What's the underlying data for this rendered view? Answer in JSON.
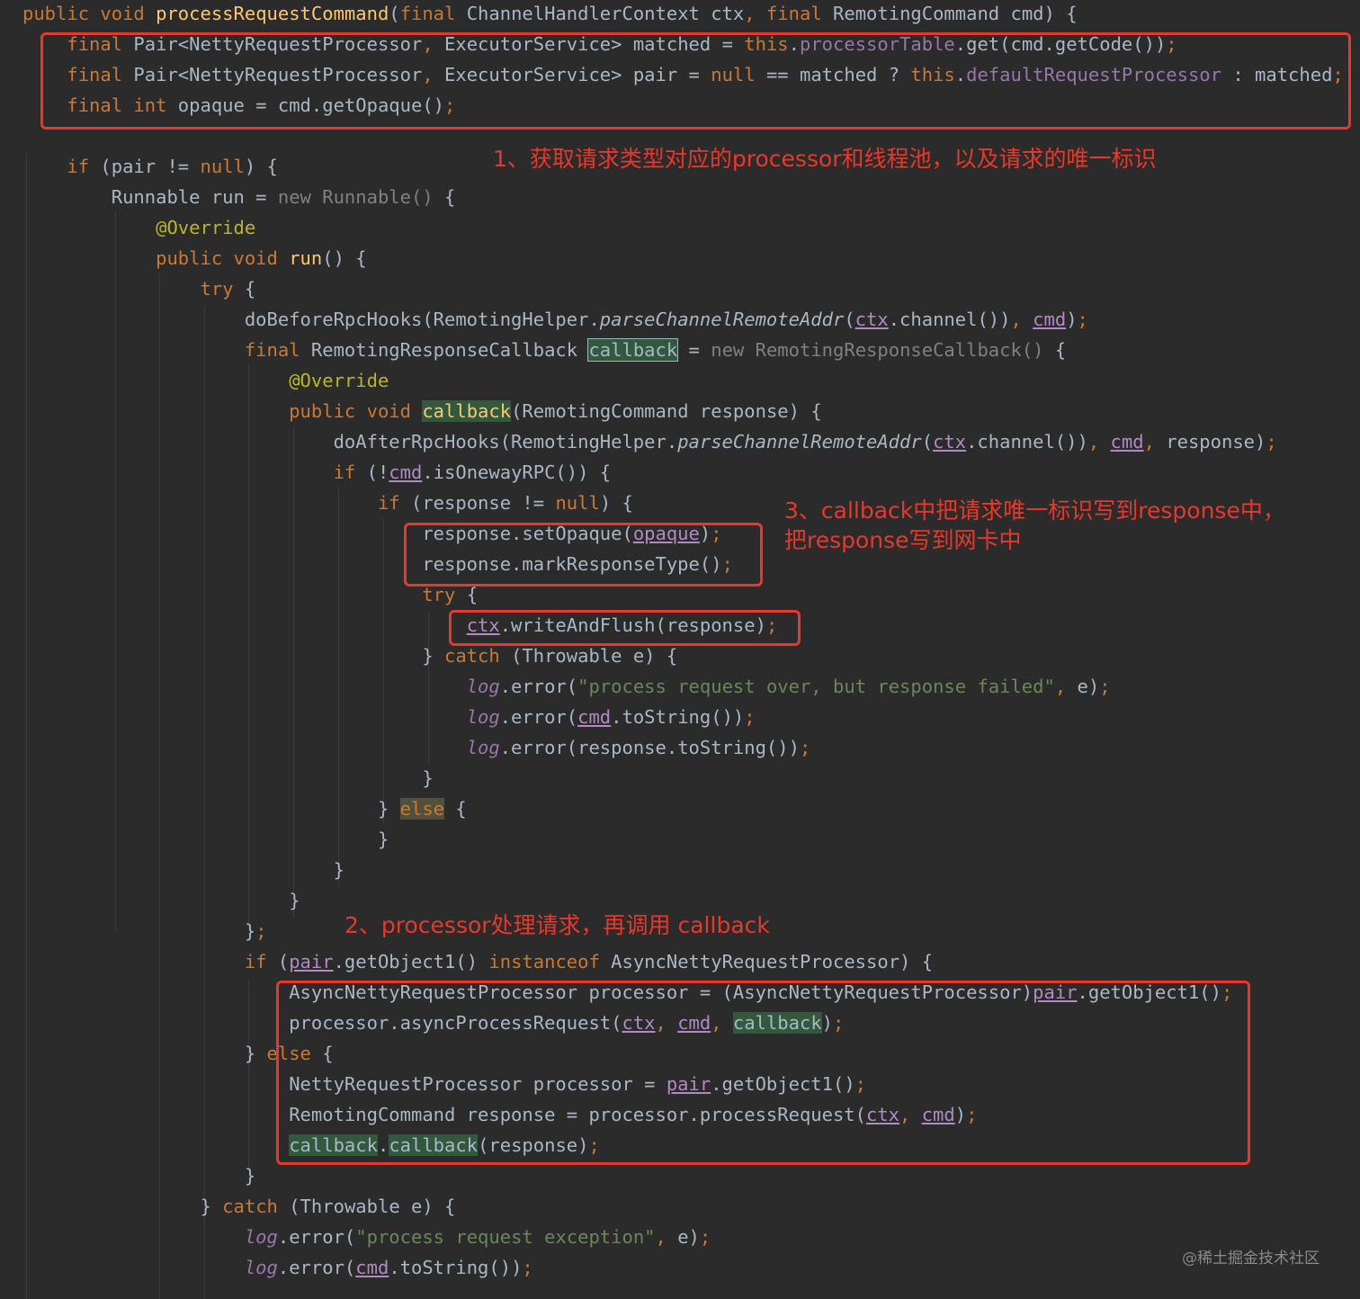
{
  "code_lines": [
    {
      "n": 0,
      "tokens": [
        [
          "public void ",
          "k"
        ],
        [
          "processRequestCommand",
          "m"
        ],
        [
          "(",
          "t"
        ],
        [
          "final ",
          "k"
        ],
        [
          "ChannelHandlerContext ctx",
          "t"
        ],
        [
          ", ",
          "k"
        ],
        [
          "final ",
          "k"
        ],
        [
          "RemotingCommand cmd) {",
          "t"
        ]
      ]
    },
    {
      "n": 1,
      "tokens": [
        [
          "    final ",
          "k"
        ],
        [
          "Pair<NettyRequestProcessor",
          "t"
        ],
        [
          ", ",
          "k"
        ],
        [
          "ExecutorService> matched = ",
          "t"
        ],
        [
          "this",
          "k"
        ],
        [
          ".",
          "t"
        ],
        [
          "processorTable",
          "f"
        ],
        [
          ".get(cmd.getCode())",
          "t"
        ],
        [
          ";",
          "k"
        ]
      ]
    },
    {
      "n": 2,
      "tokens": [
        [
          "    final ",
          "k"
        ],
        [
          "Pair<NettyRequestProcessor",
          "t"
        ],
        [
          ", ",
          "k"
        ],
        [
          "ExecutorService> pair = ",
          "t"
        ],
        [
          "null ",
          "k"
        ],
        [
          "== matched ? ",
          "t"
        ],
        [
          "this",
          "k"
        ],
        [
          ".",
          "t"
        ],
        [
          "defaultRequestProcessor",
          "f"
        ],
        [
          " : matched",
          "t"
        ],
        [
          ";",
          "k"
        ]
      ]
    },
    {
      "n": 3,
      "tokens": [
        [
          "    final int ",
          "k"
        ],
        [
          "opaque = cmd.getOpaque()",
          "t"
        ],
        [
          ";",
          "k"
        ]
      ]
    },
    {
      "n": 5,
      "tokens": [
        [
          "    if ",
          "k"
        ],
        [
          "(pair != ",
          "t"
        ],
        [
          "null",
          "k"
        ],
        [
          ") {",
          "t"
        ]
      ]
    },
    {
      "n": 6,
      "tokens": [
        [
          "        Runnable run = ",
          "t"
        ],
        [
          "new Runnable() ",
          "g"
        ],
        [
          "{",
          "t"
        ]
      ]
    },
    {
      "n": 7,
      "tokens": [
        [
          "            @Override",
          "a"
        ]
      ]
    },
    {
      "n": 8,
      "tokens": [
        [
          "            public void ",
          "k"
        ],
        [
          "run",
          "m"
        ],
        [
          "() {",
          "t"
        ]
      ]
    },
    {
      "n": 9,
      "tokens": [
        [
          "                try ",
          "k"
        ],
        [
          "{",
          "t"
        ]
      ]
    },
    {
      "n": 10,
      "tokens": [
        [
          "                    doBeforeRpcHooks(RemotingHelper.",
          "t"
        ],
        [
          "parseChannelRemoteAddr",
          "i"
        ],
        [
          "(",
          "t"
        ],
        [
          "ctx",
          "u"
        ],
        [
          ".channel())",
          "t"
        ],
        [
          ", ",
          "k"
        ],
        [
          "cmd",
          "u"
        ],
        [
          ")",
          "t"
        ],
        [
          ";",
          "k"
        ]
      ]
    },
    {
      "n": 11,
      "tokens": [
        [
          "                    final ",
          "k"
        ],
        [
          "RemotingResponseCallback ",
          "t"
        ],
        [
          "callback",
          "hb"
        ],
        [
          " = ",
          "t"
        ],
        [
          "new RemotingResponseCallback() ",
          "g"
        ],
        [
          "{",
          "t"
        ]
      ]
    },
    {
      "n": 12,
      "tokens": [
        [
          "                        @Override",
          "a"
        ]
      ]
    },
    {
      "n": 13,
      "tokens": [
        [
          "                        public void ",
          "k"
        ],
        [
          "callback",
          "hm"
        ],
        [
          "(RemotingCommand response) {",
          "t"
        ]
      ]
    },
    {
      "n": 14,
      "tokens": [
        [
          "                            doAfterRpcHooks(RemotingHelper.",
          "t"
        ],
        [
          "parseChannelRemoteAddr",
          "i"
        ],
        [
          "(",
          "t"
        ],
        [
          "ctx",
          "u"
        ],
        [
          ".channel())",
          "t"
        ],
        [
          ", ",
          "k"
        ],
        [
          "cmd",
          "u"
        ],
        [
          ", ",
          "k"
        ],
        [
          "response)",
          "t"
        ],
        [
          ";",
          "k"
        ]
      ]
    },
    {
      "n": 15,
      "tokens": [
        [
          "                            if ",
          "k"
        ],
        [
          "(!",
          "t"
        ],
        [
          "cmd",
          "u"
        ],
        [
          ".isOnewayRPC()) {",
          "t"
        ]
      ]
    },
    {
      "n": 16,
      "tokens": [
        [
          "                                if ",
          "k"
        ],
        [
          "(response != ",
          "t"
        ],
        [
          "null",
          "k"
        ],
        [
          ") {",
          "t"
        ]
      ]
    },
    {
      "n": 17,
      "tokens": [
        [
          "                                    response.setOpaque(",
          "t"
        ],
        [
          "opaque",
          "u"
        ],
        [
          ")",
          "t"
        ],
        [
          ";",
          "k"
        ]
      ]
    },
    {
      "n": 18,
      "tokens": [
        [
          "                                    response.markResponseType()",
          "t"
        ],
        [
          ";",
          "k"
        ]
      ]
    },
    {
      "n": 19,
      "tokens": [
        [
          "                                    try ",
          "k"
        ],
        [
          "{",
          "t"
        ]
      ]
    },
    {
      "n": 20,
      "tokens": [
        [
          "                                        ",
          "t"
        ],
        [
          "ctx",
          "u"
        ],
        [
          ".writeAndFlush(response)",
          "t"
        ],
        [
          ";",
          "k"
        ]
      ]
    },
    {
      "n": 21,
      "tokens": [
        [
          "                                    } ",
          "t"
        ],
        [
          "catch ",
          "k"
        ],
        [
          "(Throwable e) {",
          "t"
        ]
      ]
    },
    {
      "n": 22,
      "tokens": [
        [
          "                                        ",
          "t"
        ],
        [
          "log",
          "l"
        ],
        [
          ".error(",
          "t"
        ],
        [
          "\"process request over, but response failed\"",
          "s"
        ],
        [
          ", ",
          "k"
        ],
        [
          "e)",
          "t"
        ],
        [
          ";",
          "k"
        ]
      ]
    },
    {
      "n": 23,
      "tokens": [
        [
          "                                        ",
          "t"
        ],
        [
          "log",
          "l"
        ],
        [
          ".error(",
          "t"
        ],
        [
          "cmd",
          "u"
        ],
        [
          ".toString())",
          "t"
        ],
        [
          ";",
          "k"
        ]
      ]
    },
    {
      "n": 24,
      "tokens": [
        [
          "                                        ",
          "t"
        ],
        [
          "log",
          "l"
        ],
        [
          ".error(response.toString())",
          "t"
        ],
        [
          ";",
          "k"
        ]
      ]
    },
    {
      "n": 25,
      "tokens": [
        [
          "                                    }",
          "t"
        ]
      ]
    },
    {
      "n": 26,
      "tokens": [
        [
          "                                } ",
          "t"
        ],
        [
          "else",
          "e"
        ],
        [
          " {",
          "t"
        ]
      ]
    },
    {
      "n": 27,
      "tokens": [
        [
          "                                }",
          "t"
        ]
      ]
    },
    {
      "n": 28,
      "tokens": [
        [
          "                            }",
          "t"
        ]
      ]
    },
    {
      "n": 29,
      "tokens": [
        [
          "                        }",
          "t"
        ]
      ]
    },
    {
      "n": 30,
      "tokens": [
        [
          "                    }",
          "t"
        ],
        [
          ";",
          "k"
        ]
      ]
    },
    {
      "n": 31,
      "tokens": [
        [
          "                    if ",
          "k"
        ],
        [
          "(",
          "t"
        ],
        [
          "pair",
          "u"
        ],
        [
          ".getObject1() ",
          "t"
        ],
        [
          "instanceof ",
          "k"
        ],
        [
          "AsyncNettyRequestProcessor) {",
          "t"
        ]
      ]
    },
    {
      "n": 32,
      "tokens": [
        [
          "                        AsyncNettyRequestProcessor processor = (AsyncNettyRequestProcessor)",
          "t"
        ],
        [
          "pair",
          "u"
        ],
        [
          ".getObject1()",
          "t"
        ],
        [
          ";",
          "k"
        ]
      ]
    },
    {
      "n": 33,
      "tokens": [
        [
          "                        processor.asyncProcessRequest(",
          "t"
        ],
        [
          "ctx",
          "u"
        ],
        [
          ", ",
          "k"
        ],
        [
          "cmd",
          "u"
        ],
        [
          ", ",
          "k"
        ],
        [
          "callback",
          "h"
        ],
        [
          ")",
          "t"
        ],
        [
          ";",
          "k"
        ]
      ]
    },
    {
      "n": 34,
      "tokens": [
        [
          "                    } ",
          "t"
        ],
        [
          "else ",
          "k"
        ],
        [
          "{",
          "t"
        ]
      ]
    },
    {
      "n": 35,
      "tokens": [
        [
          "                        NettyRequestProcessor processor = ",
          "t"
        ],
        [
          "pair",
          "u"
        ],
        [
          ".getObject1()",
          "t"
        ],
        [
          ";",
          "k"
        ]
      ]
    },
    {
      "n": 36,
      "tokens": [
        [
          "                        RemotingCommand response = processor.processRequest(",
          "t"
        ],
        [
          "ctx",
          "u"
        ],
        [
          ", ",
          "k"
        ],
        [
          "cmd",
          "u"
        ],
        [
          ")",
          "t"
        ],
        [
          ";",
          "k"
        ]
      ]
    },
    {
      "n": 37,
      "tokens": [
        [
          "                        ",
          "t"
        ],
        [
          "callback",
          "h"
        ],
        [
          ".",
          "t"
        ],
        [
          "callback",
          "h"
        ],
        [
          "(response)",
          "t"
        ],
        [
          ";",
          "k"
        ]
      ]
    },
    {
      "n": 38,
      "tokens": [
        [
          "                    }",
          "t"
        ]
      ]
    },
    {
      "n": 39,
      "tokens": [
        [
          "                } ",
          "t"
        ],
        [
          "catch ",
          "k"
        ],
        [
          "(Throwable e) {",
          "t"
        ]
      ]
    },
    {
      "n": 40,
      "tokens": [
        [
          "                    ",
          "t"
        ],
        [
          "log",
          "l"
        ],
        [
          ".error(",
          "t"
        ],
        [
          "\"process request exception\"",
          "s"
        ],
        [
          ", ",
          "k"
        ],
        [
          "e)",
          "t"
        ],
        [
          ";",
          "k"
        ]
      ]
    },
    {
      "n": 41,
      "tokens": [
        [
          "                    ",
          "t"
        ],
        [
          "log",
          "l"
        ],
        [
          ".error(",
          "t"
        ],
        [
          "cmd",
          "u"
        ],
        [
          ".toString())",
          "t"
        ],
        [
          ";",
          "k"
        ]
      ]
    }
  ],
  "annotations": {
    "note1": "1、获取请求类型对应的processor和线程池，以及请求的唯一标识",
    "note2": "2、processor处理请求，再调用 callback",
    "note3_line1": "3、callback中把请求唯一标识写到response中，",
    "note3_line2": "把response写到网卡中"
  },
  "watermark": "@稀土掘金技术社区",
  "colors": {
    "background": "#2b2b2b",
    "keyword": "#cc7832",
    "text": "#a9b7c6",
    "annotation_red": "#e8382c"
  }
}
